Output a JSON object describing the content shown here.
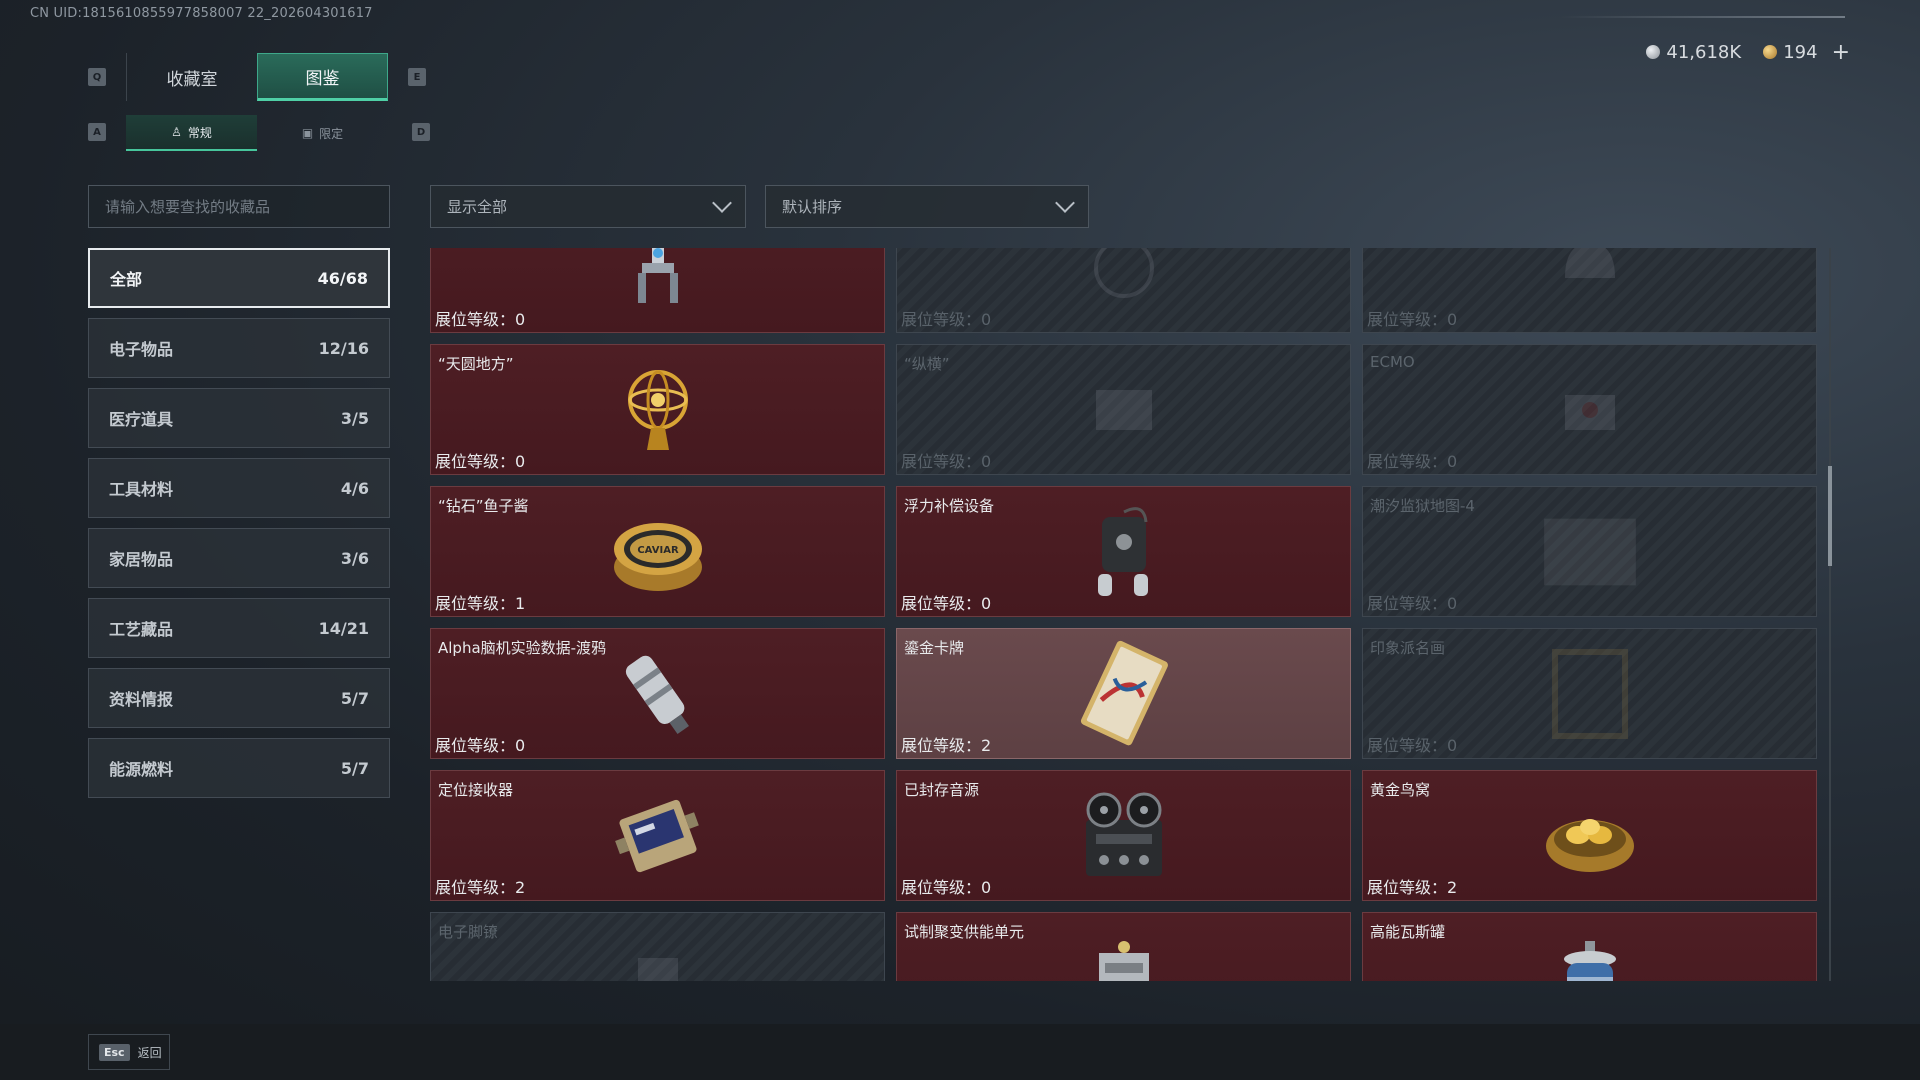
{
  "uid": "CN UID:1815610855977858007 22_202604301617",
  "currency": {
    "silver": "41,618K",
    "gold": "194",
    "plus": "+"
  },
  "keys": {
    "q": "Q",
    "e": "E",
    "a": "A",
    "d": "D"
  },
  "tabs": [
    {
      "label": "收藏室"
    },
    {
      "label": "图鉴"
    }
  ],
  "subtabs": [
    {
      "label": "常规"
    },
    {
      "label": "限定"
    }
  ],
  "search": {
    "placeholder": "请输入想要查找的收藏品"
  },
  "filters": {
    "show": "显示全部",
    "sort": "默认排序"
  },
  "categories": [
    {
      "label": "全部",
      "count": "46/68"
    },
    {
      "label": "电子物品",
      "count": "12/16"
    },
    {
      "label": "医疗道具",
      "count": "3/5"
    },
    {
      "label": "工具材料",
      "count": "4/6"
    },
    {
      "label": "家居物品",
      "count": "3/6"
    },
    {
      "label": "工艺藏品",
      "count": "14/21"
    },
    {
      "label": "资料情报",
      "count": "5/7"
    },
    {
      "label": "能源燃料",
      "count": "5/7"
    }
  ],
  "items": [
    {
      "name": "",
      "level": "展位等级：0",
      "state": "owned",
      "icon": "robot-arm-icon"
    },
    {
      "name": "",
      "level": "展位等级：0",
      "state": "locked",
      "icon": "globe-icon"
    },
    {
      "name": "",
      "level": "展位等级：0",
      "state": "locked",
      "icon": "helmet-icon"
    },
    {
      "name": "“天圆地方”",
      "level": "展位等级：0",
      "state": "owned",
      "icon": "armillary-sphere-icon"
    },
    {
      "name": "“纵横”",
      "level": "展位等级：0",
      "state": "locked",
      "icon": "chessboard-icon"
    },
    {
      "name": "ECMO",
      "level": "展位等级：0",
      "state": "locked",
      "icon": "ecmo-machine-icon"
    },
    {
      "name": "“钻石”鱼子酱",
      "level": "展位等级：1",
      "state": "owned",
      "icon": "caviar-tin-icon"
    },
    {
      "name": "浮力补偿设备",
      "level": "展位等级：0",
      "state": "owned",
      "icon": "buoyancy-device-icon"
    },
    {
      "name": "潮汐监狱地图-4",
      "level": "展位等级：0",
      "state": "locked",
      "icon": "map-icon"
    },
    {
      "name": "Alpha脑机实验数据-渡鸦",
      "level": "展位等级：0",
      "state": "owned",
      "icon": "data-canister-icon"
    },
    {
      "name": "鎏金卡牌",
      "level": "展位等级：2",
      "state": "highlight",
      "icon": "gilded-card-icon"
    },
    {
      "name": "印象派名画",
      "level": "展位等级：0",
      "state": "locked",
      "icon": "painting-frame-icon"
    },
    {
      "name": "定位接收器",
      "level": "展位等级：2",
      "state": "owned",
      "icon": "gps-receiver-icon"
    },
    {
      "name": "已封存音源",
      "level": "展位等级：0",
      "state": "owned",
      "icon": "tape-recorder-icon"
    },
    {
      "name": "黄金鸟窝",
      "level": "展位等级：2",
      "state": "owned",
      "icon": "golden-nest-icon"
    },
    {
      "name": "电子脚镣",
      "level": "",
      "state": "locked",
      "icon": "ankle-monitor-icon"
    },
    {
      "name": "试制聚变供能单元",
      "level": "",
      "state": "owned",
      "icon": "fusion-cell-icon"
    },
    {
      "name": "高能瓦斯罐",
      "level": "",
      "state": "owned",
      "icon": "gas-canister-icon"
    }
  ],
  "footer": {
    "esc_key": "Esc",
    "back_label": "返回"
  },
  "colors": {
    "accent": "#47c69c",
    "owned_bg": "#4e1e24",
    "locked_bg": "#2a3037"
  }
}
